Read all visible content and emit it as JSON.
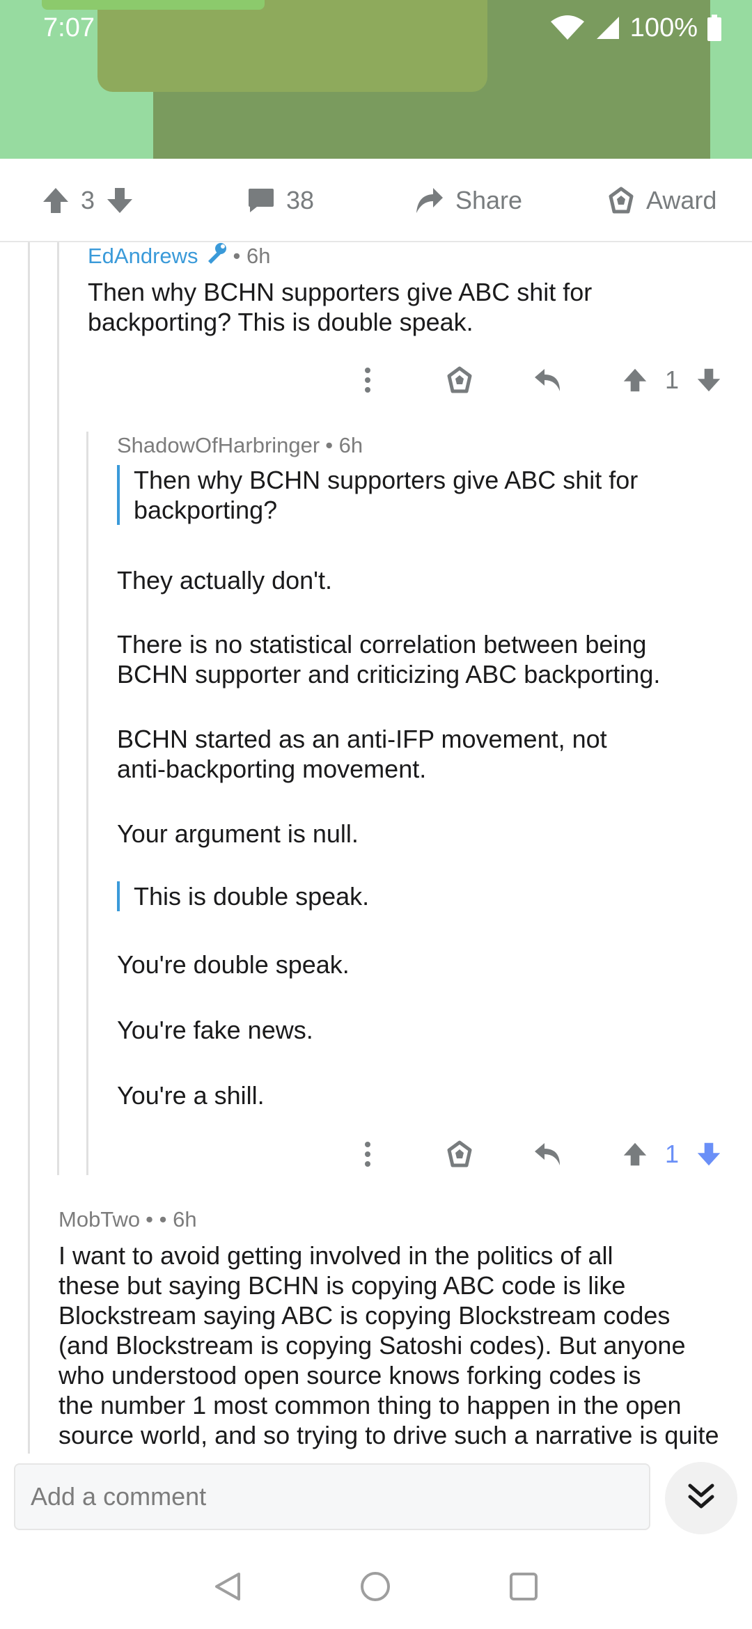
{
  "status_bar": {
    "time": "7:07",
    "battery": "100%"
  },
  "post_actions": {
    "upvote_count": "3",
    "comment_count": "38",
    "share_label": "Share",
    "award_label": "Award"
  },
  "comments": [
    {
      "author": "EdAndrews",
      "time": "• 6h",
      "lines": [
        "Then why BCHN supporters give ABC shit for",
        "backporting? This is double speak."
      ],
      "score": "1"
    },
    {
      "author": "ShadowOfHarbringer",
      "time": "• 6h",
      "quote1": [
        "Then why BCHN supporters give ABC shit for",
        "backporting?"
      ],
      "p1": "They actually don't.",
      "p2": [
        "There is no statistical correlation between being",
        "BCHN supporter and criticizing ABC backporting."
      ],
      "p3": [
        "BCHN started as an anti-IFP movement, not",
        "anti-backporting movement."
      ],
      "p4": "Your argument is null.",
      "quote2": "This is double speak.",
      "p5": "You're double speak.",
      "p6": "You're fake news.",
      "p7": "You're a shill.",
      "score": "1"
    },
    {
      "author": "MobTwo",
      "time": "• • 6h",
      "lines": [
        "I want to avoid getting involved in the politics of all",
        "these but saying BCHN is copying ABC code is like",
        "Blockstream saying ABC is copying Blockstream codes",
        "(and Blockstream is copying Satoshi codes). But anyone",
        "who understood open source knows forking codes is",
        "the number 1 most common thing to happen in the open",
        "source world, and so trying to drive such a narrative is quite"
      ]
    }
  ],
  "composer": {
    "placeholder": "Add a comment"
  },
  "colors": {
    "accent_blue": "#3a9ad9",
    "vote_blue": "#6a8ff7"
  }
}
